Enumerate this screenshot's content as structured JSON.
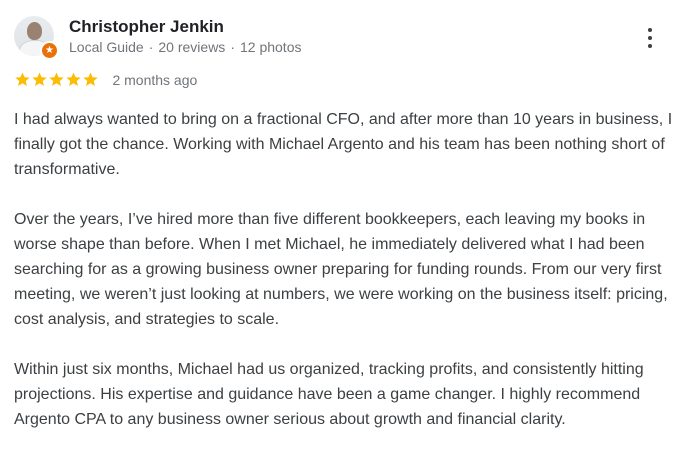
{
  "reviewer": {
    "name": "Christopher Jenkin",
    "badge": "Local Guide",
    "separator": "·",
    "reviews": "20 reviews",
    "photos": "12 photos",
    "avatar_icon": "user-avatar",
    "badge_icon": "local-guide-star-icon"
  },
  "rating": {
    "stars": 5,
    "max": 5,
    "star_color": "#fbbc04",
    "date": "2 months ago"
  },
  "menu": {
    "icon": "more-vertical-icon"
  },
  "review": {
    "paragraphs": [
      "I had always wanted to bring on a fractional CFO, and after more than 10 years in business, I finally got the chance. Working with Michael Argento and his team has been nothing short of transformative.",
      "Over the years, I’ve hired more than five different bookkeepers, each leaving my books in worse shape than before. When I met Michael, he immediately delivered what I had been searching for as a growing business owner preparing for funding rounds. From our very first meeting, we weren’t just looking at numbers, we were working on the business itself: pricing, cost analysis, and strategies to scale.",
      "Within just six months, Michael had us organized, tracking profits, and consistently hitting projections. His expertise and guidance have been a game changer. I highly recommend Argento CPA to any business owner serious about growth and financial clarity."
    ]
  },
  "colors": {
    "name": "#202124",
    "meta": "#70757a",
    "body": "#3c4043",
    "badge": "#e8710a"
  }
}
